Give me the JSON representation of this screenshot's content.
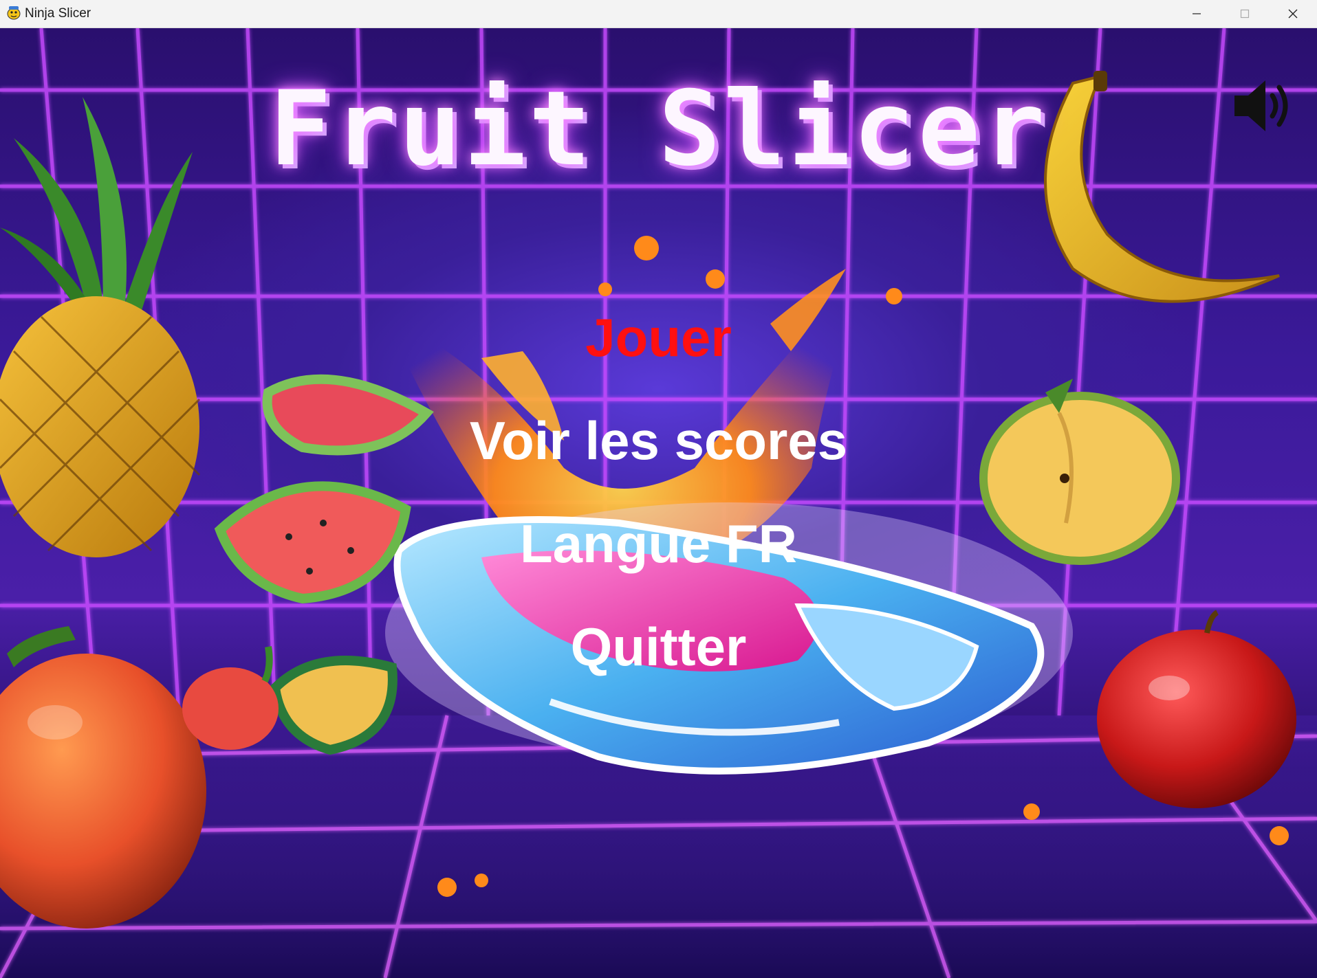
{
  "window": {
    "title": "Ninja Slicer",
    "app_icon": "pygame-snake-icon",
    "controls": [
      "minimize-icon",
      "maximize-icon",
      "close-icon"
    ]
  },
  "game": {
    "title": "Fruit Slicer",
    "sound_icon": "speaker-volume-icon"
  },
  "menu": {
    "play": "Jouer",
    "scores": "Voir les scores",
    "language": "Langue FR",
    "quit": "Quitter"
  },
  "colors": {
    "selected_item": "#ff1010",
    "menu_item": "#ffffff",
    "title_glow": "#ff8cff",
    "grid_neon": "#c84cff"
  }
}
